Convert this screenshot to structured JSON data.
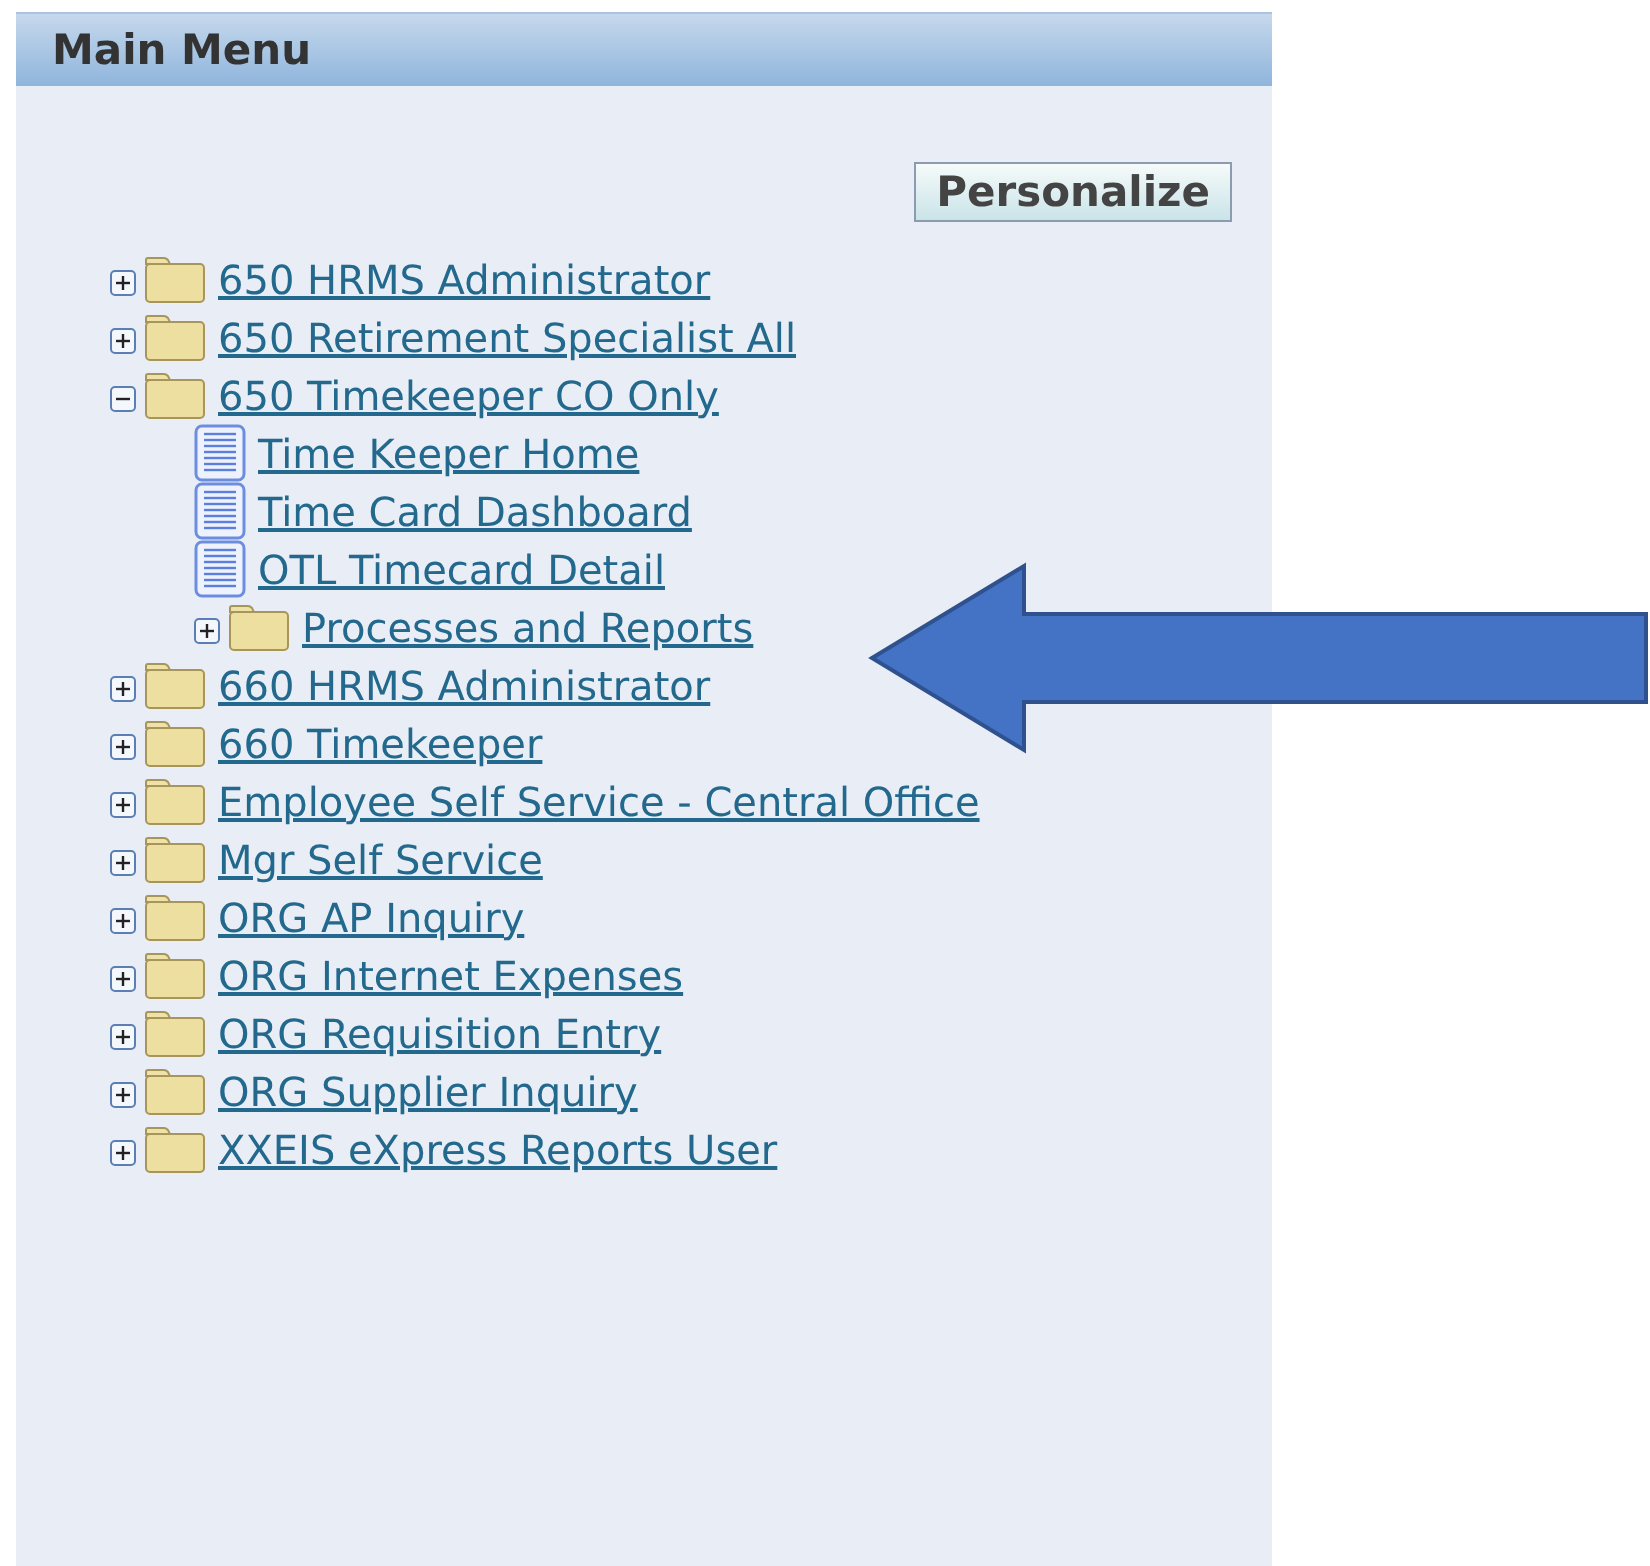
{
  "panel": {
    "title": "Main Menu"
  },
  "personalize_button": "Personalize",
  "tree": [
    {
      "kind": "folder",
      "label": "650 HRMS Administrator",
      "expanded": false
    },
    {
      "kind": "folder",
      "label": "650 Retirement Specialist All",
      "expanded": false
    },
    {
      "kind": "folder",
      "label": "650 Timekeeper CO Only",
      "expanded": true,
      "children": [
        {
          "kind": "page",
          "label": "Time Keeper Home"
        },
        {
          "kind": "page",
          "label": "Time Card Dashboard"
        },
        {
          "kind": "page",
          "label": "OTL Timecard Detail"
        },
        {
          "kind": "folder",
          "label": "Processes and Reports",
          "expanded": false
        }
      ]
    },
    {
      "kind": "folder",
      "label": "660 HRMS Administrator",
      "expanded": false
    },
    {
      "kind": "folder",
      "label": "660 Timekeeper",
      "expanded": false
    },
    {
      "kind": "folder",
      "label": "Employee Self Service - Central Office",
      "expanded": false
    },
    {
      "kind": "folder",
      "label": "Mgr Self Service",
      "expanded": false
    },
    {
      "kind": "folder",
      "label": "ORG AP Inquiry",
      "expanded": false
    },
    {
      "kind": "folder",
      "label": "ORG Internet Expenses",
      "expanded": false
    },
    {
      "kind": "folder",
      "label": "ORG Requisition Entry",
      "expanded": false
    },
    {
      "kind": "folder",
      "label": "ORG Supplier Inquiry",
      "expanded": false
    },
    {
      "kind": "folder",
      "label": "XXEIS eXpress Reports User",
      "expanded": false
    }
  ]
}
